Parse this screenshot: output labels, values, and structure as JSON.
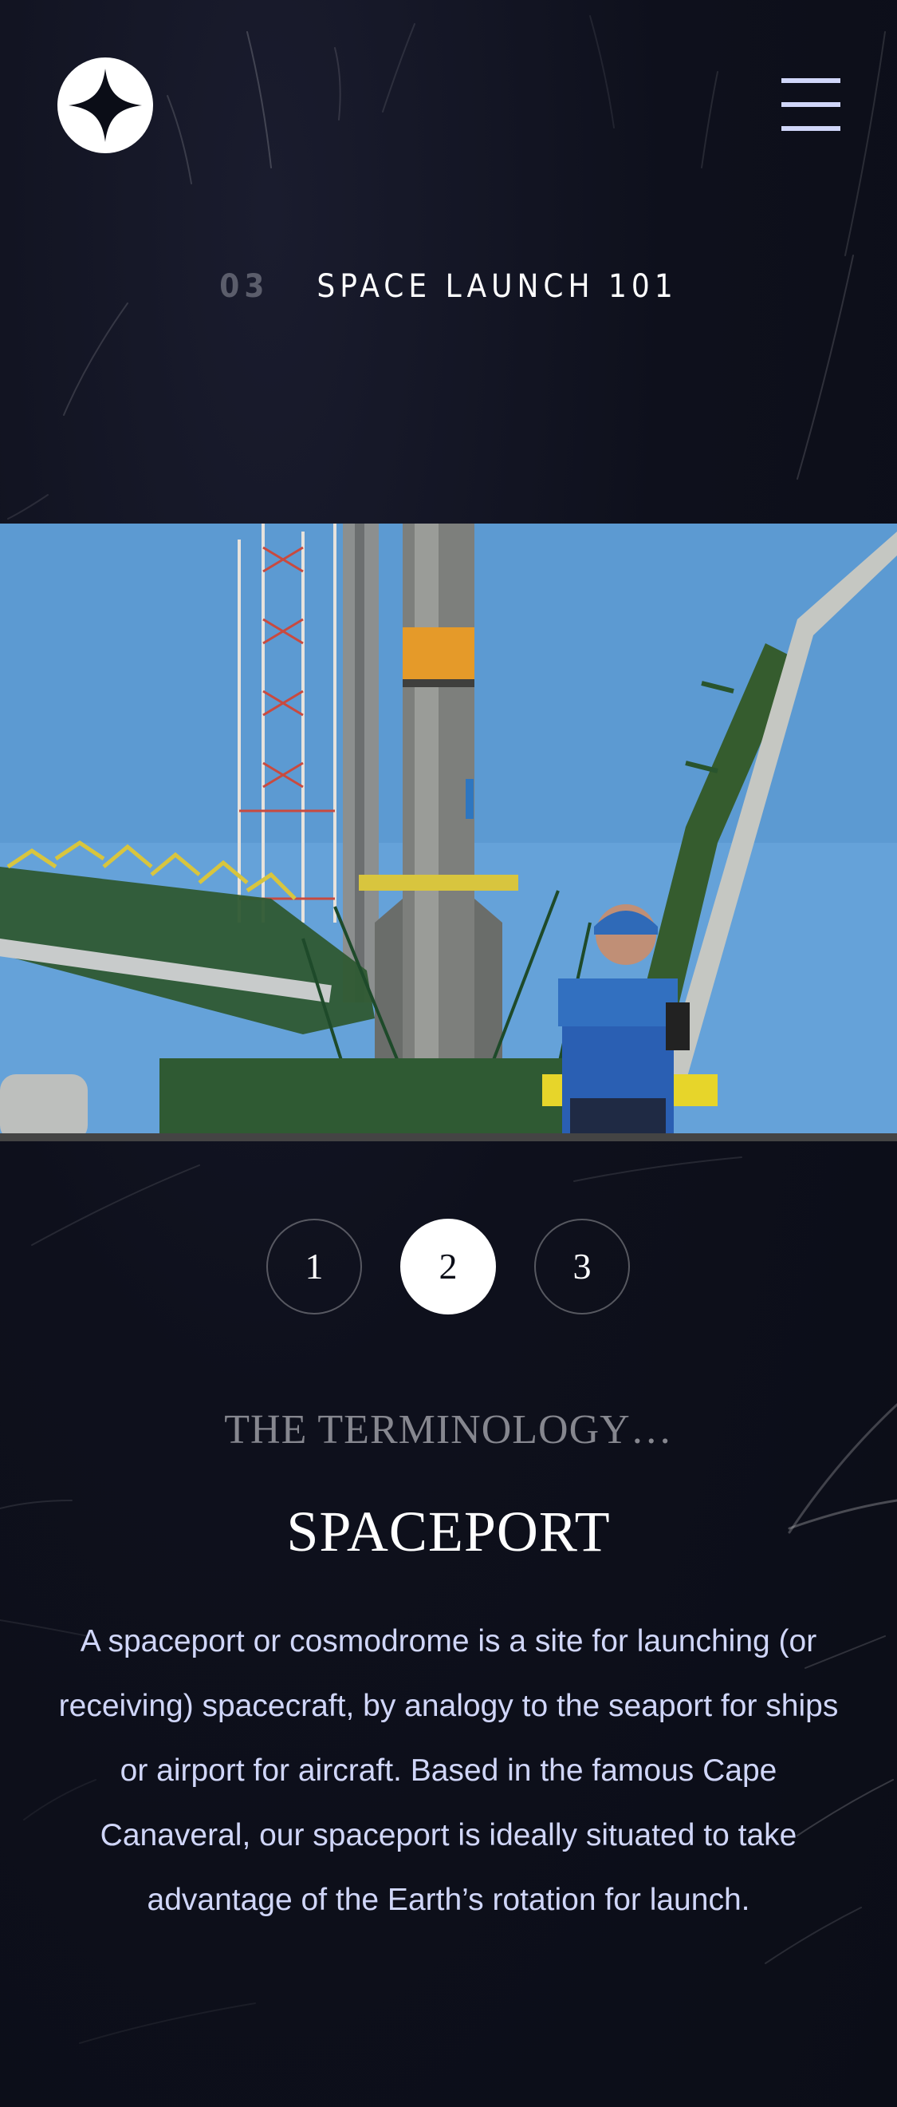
{
  "nav": {
    "logo_name": "star-logo",
    "menu_icon": "hamburger-menu-icon"
  },
  "page_heading": {
    "number": "03",
    "title": "SPACE LAUNCH 101"
  },
  "hero_image": {
    "description_icon": "rocket-launch-photo"
  },
  "pager": {
    "items": [
      "1",
      "2",
      "3"
    ],
    "active": "2"
  },
  "content": {
    "kicker": "THE TERMINOLOGY…",
    "title": "SPACEPORT",
    "description": "A spaceport or cosmodrome is a site for launching (or receiving) spacecraft, by analogy to the seaport for ships or airport for aircraft. Based in the famous Cape Canaveral, our spaceport is ideally situated to take advantage of the Earth’s rotation for launch."
  },
  "colors": {
    "background": "#0b0d17",
    "text_muted": "#d0d6f9",
    "accent_white": "#ffffff"
  }
}
